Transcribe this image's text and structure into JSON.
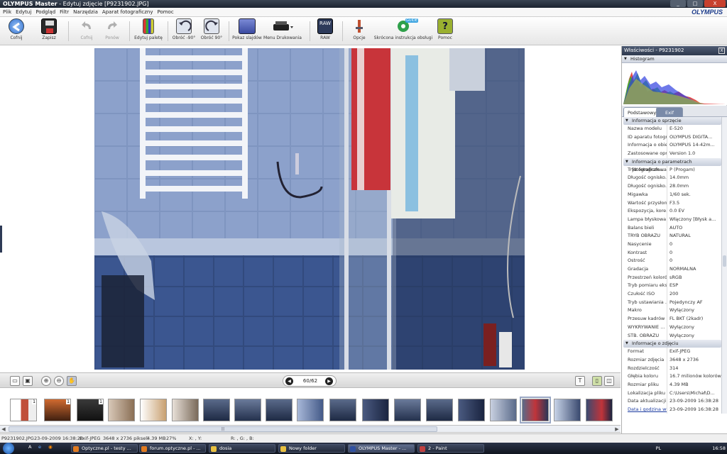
{
  "window": {
    "app_name": "OLYMPUS Master",
    "doc_title": " - Edytuj zdjęcie [P9231902.JPG]",
    "min": "_",
    "max": "□",
    "close": "X"
  },
  "menu": {
    "items": [
      "Plik",
      "Edytuj",
      "Podgląd",
      "Filtr",
      "Narzędzia",
      "Aparat fotograficzny",
      "Pomoc"
    ],
    "brand": "OLYMPUS"
  },
  "toolbar": {
    "buttons": [
      {
        "label": "Cofnij",
        "icon": "back-arrow-icon",
        "color": "#2f6fd0",
        "disabled": false
      },
      {
        "label": "Zapisz",
        "icon": "floppy-save-icon",
        "color": "#333333",
        "disabled": false
      },
      {
        "label": "Cofnij",
        "icon": "undo-icon",
        "color": "#b0b0b0",
        "disabled": true
      },
      {
        "label": "Ponów",
        "icon": "redo-icon",
        "color": "#b0b0b0",
        "disabled": true
      },
      {
        "label": "Edytuj paletę",
        "icon": "palette-icon",
        "color": "#7a5aa8",
        "disabled": false
      },
      {
        "label": "Obróć -90°",
        "icon": "rotate-left-icon",
        "color": "#4a5a80",
        "disabled": false
      },
      {
        "label": "Obróć 90°",
        "icon": "rotate-right-icon",
        "color": "#4a5a80",
        "disabled": false
      },
      {
        "label": "Pokaz slajdów",
        "icon": "slideshow-icon",
        "color": "#5a6ab0",
        "disabled": false
      },
      {
        "label": "Menu Drukowania",
        "icon": "printer-icon",
        "color": "#222222",
        "disabled": false
      },
      {
        "label": "RAW",
        "icon": "raw-icon",
        "color": "#3a4a70",
        "disabled": false
      },
      {
        "label": "Opcje",
        "icon": "options-icon",
        "color": "#c05030",
        "disabled": false
      },
      {
        "label": "Skrócona instrukcja obsługi",
        "icon": "guide-icon",
        "color": "#2fa04a",
        "disabled": false
      },
      {
        "label": "Pomoc",
        "icon": "help-icon",
        "color": "#9ab030",
        "disabled": false
      }
    ],
    "raw_badge": "RAW",
    "guide_badge": "GUIDE",
    "help_glyph": "?"
  },
  "viewbar": {
    "page": "60/62",
    "prev": "◀",
    "next": "▶"
  },
  "filmstrip": {
    "badges": [
      "1",
      "1",
      "1"
    ],
    "scroll_left": "◀",
    "scroll_right": "▶",
    "grip": "|||"
  },
  "status": {
    "filename": "P9231902.JPG",
    "datetime": "23-09-2009 16:38:28",
    "format": "Exif-JPEG",
    "pixels": "3648 x 2736 pikseli",
    "size": "4.39 MB",
    "zoom": "27%",
    "xy": "X: , Y:",
    "rgb": "R: , G: , B:"
  },
  "panel": {
    "title": "Właściwości - P9231902",
    "close": "X",
    "histogram_label": "Histogram",
    "tabs": [
      "Podstawowy",
      "Exif"
    ],
    "groups": [
      {
        "title": "Informacja o sprzęcie",
        "rows": [
          {
            "k": "Nazwa modelu",
            "v": "E-520"
          },
          {
            "k": "ID aparatu fotogr...",
            "v": "OLYMPUS DIGITA..."
          },
          {
            "k": "Informacja o obie...",
            "v": "OLYMPUS 14-42m..."
          },
          {
            "k": "Zastosowane opr...",
            "v": "Version 1.0"
          }
        ]
      },
      {
        "title": "Informacja o parametrach fotograficzn...",
        "rows": [
          {
            "k": "Tryb fotografowa...",
            "v": "P (Progam)"
          },
          {
            "k": "Długość ognisko...",
            "v": "14.0mm"
          },
          {
            "k": "Długość ognisko...",
            "v": "28.0mm"
          },
          {
            "k": "Migawka",
            "v": "1/60 sek."
          },
          {
            "k": "Wartość przysłony",
            "v": "F3.5"
          },
          {
            "k": "Ekspozycja, kore...",
            "v": "0.0 EV"
          },
          {
            "k": "Lampa błyskowa",
            "v": "Włączony [Błysk a..."
          },
          {
            "k": "Balans bieli",
            "v": "AUTO"
          },
          {
            "k": "TRYB OBRAZU",
            "v": "NATURAL"
          },
          {
            "k": "Nasycenie",
            "v": "0"
          },
          {
            "k": "Kontrast",
            "v": "0"
          },
          {
            "k": "Ostrość",
            "v": "0"
          },
          {
            "k": "Gradacja",
            "v": "NORMALNA"
          },
          {
            "k": "Przestrzeń kolorów",
            "v": "sRGB"
          },
          {
            "k": "Tryb pomiaru eks...",
            "v": "ESP"
          },
          {
            "k": "Czułość ISO",
            "v": "200"
          },
          {
            "k": "Tryb ustawiania ...",
            "v": "Pojedynczy AF"
          },
          {
            "k": "Makro",
            "v": "Wyłączony"
          },
          {
            "k": "Przesuw kadrów",
            "v": "FL BKT (2kadr)"
          },
          {
            "k": "WYKRYWANIE ...",
            "v": "Wyłączony"
          },
          {
            "k": "STB. OBRAZU",
            "v": "Wyłączony"
          }
        ]
      },
      {
        "title": "Informacje o zdjęciu",
        "rows": [
          {
            "k": "Format",
            "v": "Exif-JPEG"
          },
          {
            "k": "Rozmiar zdjęcia",
            "v": "3648 x 2736"
          },
          {
            "k": "Rozdzielczość",
            "v": "314"
          },
          {
            "k": "Głębia koloru",
            "v": "16.7 milionów kolorów"
          },
          {
            "k": "Rozmiar pliku",
            "v": "4.39 MB"
          },
          {
            "k": "Lokalizacja pliku",
            "v": "C:\\Users\\Michał\\D..."
          },
          {
            "k": "Data aktualizacji",
            "v": "23-09-2009 16:38:28"
          },
          {
            "k": "Data i godzina wykon...",
            "v": "23-09-2009 16:38:28"
          }
        ]
      }
    ]
  },
  "taskbar": {
    "quick_launch": [
      "A",
      "e",
      "◉"
    ],
    "items": [
      {
        "label": "Optyczne.pl - testy ...",
        "color": "#e07a20",
        "active": false
      },
      {
        "label": "forum.optyczne.pl - ...",
        "color": "#e07a20",
        "active": false
      },
      {
        "label": "dosia",
        "color": "#e8c040",
        "active": false
      },
      {
        "label": "Nowy folder",
        "color": "#e8c040",
        "active": false
      },
      {
        "label": "OLYMPUS Master - ...",
        "color": "#3050a0",
        "active": true
      },
      {
        "label": "2 - Paint",
        "color": "#c04040",
        "active": false
      }
    ],
    "lang": "PL",
    "time": "16:58"
  }
}
